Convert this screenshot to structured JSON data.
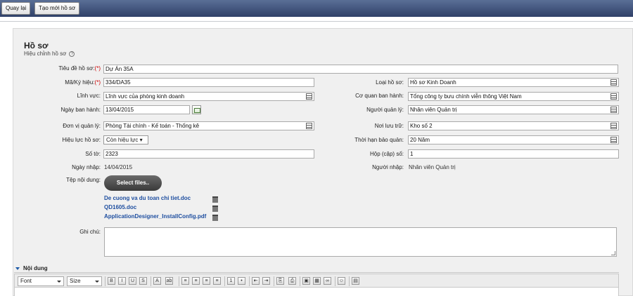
{
  "topbar": {
    "back_label": "Quay lại",
    "new_label": "Tạo mới hồ sơ"
  },
  "header": {
    "title": "Hồ sơ",
    "subtitle": "Hiệu chỉnh hồ sơ",
    "help": "?"
  },
  "form": {
    "required_mark": "(*)",
    "title": {
      "label": "Tiêu đề hồ sơ:",
      "value": "Dự Án 35A"
    },
    "code": {
      "label": "Mã/Ký hiệu:",
      "value": "334/DA35"
    },
    "type": {
      "label": "Loại hồ sơ:",
      "value": "Hồ sơ Kinh Doanh"
    },
    "field": {
      "label": "Lĩnh vực:",
      "value": "Lĩnh vực của phòng kinh doanh"
    },
    "agency": {
      "label": "Cơ quan ban hành:",
      "value": "Tổng công ty bưu chính viễn thông Việt Nam"
    },
    "issue_date": {
      "label": "Ngày ban hành:",
      "value": "13/04/2015"
    },
    "manager": {
      "label": "Người quản lý:",
      "value": "Nhân viên Quản trị"
    },
    "unit": {
      "label": "Đơn vị quản lý:",
      "value": "Phòng Tài chính - Kế toán - Thống kê"
    },
    "storage": {
      "label": "Nơi lưu trữ:",
      "value": "Kho số 2"
    },
    "validity": {
      "label": "Hiệu lực hồ sơ:",
      "value": "Còn hiệu lực"
    },
    "retention": {
      "label": "Thời hạn bảo quản:",
      "value": "20 Năm"
    },
    "sheets": {
      "label": "Số tờ:",
      "value": "2323"
    },
    "box": {
      "label": "Hộp (cập) số:",
      "value": "1"
    },
    "entry_date": {
      "label": "Ngày nhập:",
      "value": "14/04/2015"
    },
    "entry_user": {
      "label": "Người nhập:",
      "value": "Nhân viên Quản trị"
    },
    "content_files": {
      "label": "Tệp nội dung:",
      "button": "Select files..",
      "files": [
        "De cuong va du toan chi tiet.doc",
        "QD1605.doc",
        "ApplicationDesigner_InstallConfig.pdf"
      ]
    },
    "note": {
      "label": "Ghi chú:",
      "value": ""
    }
  },
  "editor": {
    "section_label": "Nội dung",
    "font_label": "Font",
    "size_label": "Size"
  },
  "icons": [
    "calendar-icon",
    "lookup-icon",
    "trash-icon",
    "help-icon",
    "bold-icon",
    "italic-icon",
    "underline-icon",
    "strike-icon"
  ]
}
